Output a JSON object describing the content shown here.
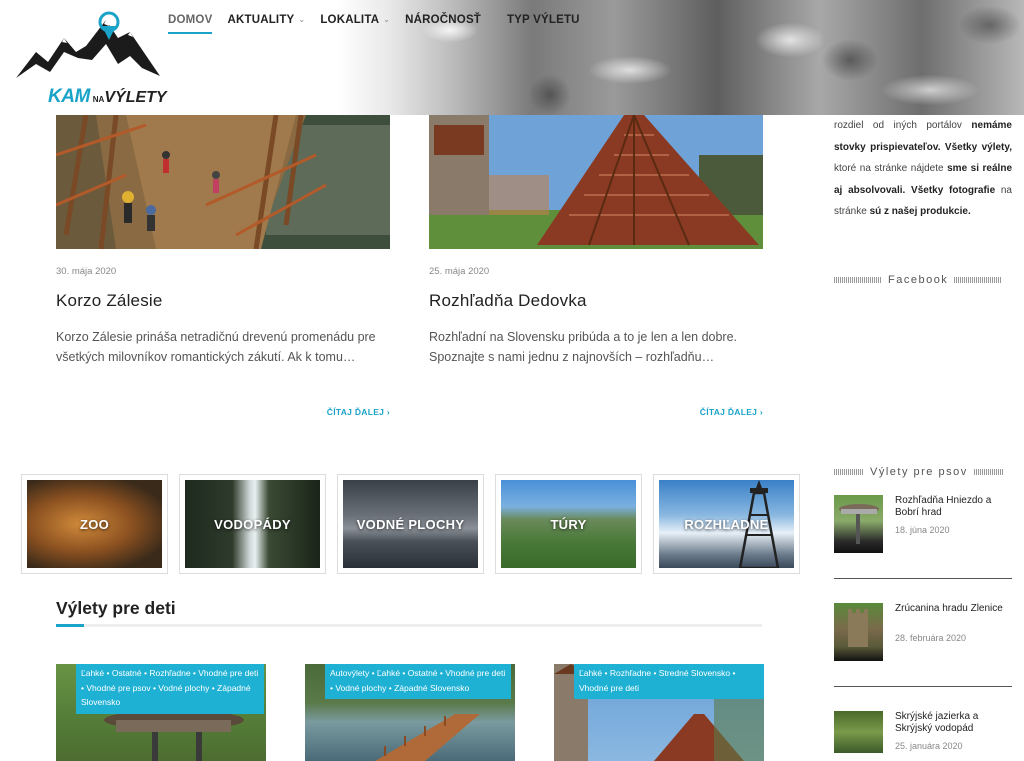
{
  "site": {
    "logo_kam": "KAM",
    "logo_na": "NA",
    "logo_vylety": "VÝLETY"
  },
  "nav": {
    "items": [
      {
        "label": "DOMOV",
        "active": true,
        "has_dropdown": false
      },
      {
        "label": "AKTUALITY",
        "active": false,
        "has_dropdown": true
      },
      {
        "label": "LOKALITA",
        "active": false,
        "has_dropdown": true
      },
      {
        "label": "NÁROČNOSŤ",
        "active": false,
        "has_dropdown": true
      },
      {
        "label": "TYP VÝLETU",
        "active": false,
        "has_dropdown": false
      }
    ]
  },
  "posts": [
    {
      "date": "30. mája 2020",
      "title": "Korzo Zálesie",
      "excerpt": "Korzo Zálesie prináša netradičnú drevenú promenádu pre všetkých milovníkov romantických zákutí. Ak k tomu…",
      "read_more": "ČÍTAJ ĎALEJ ›"
    },
    {
      "date": "25. mája 2020",
      "title": "Rozhľadňa Dedovka",
      "excerpt": "Rozhľadní na Slovensku pribúda a to je len a len dobre. Spoznajte s nami jednu z najnovších – rozhľadňu…",
      "read_more": "ČÍTAJ ĎALEJ ›"
    }
  ],
  "categories": [
    {
      "label": "ZOO"
    },
    {
      "label": "VODOPÁDY"
    },
    {
      "label": "VODNÉ PLOCHY"
    },
    {
      "label": "TÚRY"
    },
    {
      "label": "ROZHĽADNE"
    }
  ],
  "kids_section": {
    "title": "Výlety pre deti",
    "items": [
      {
        "tags": "Ľahké • Ostatné • Rozhľadne • Vhodné pre deti • Vhodné pre psov • Vodné plochy • Západné Slovensko"
      },
      {
        "tags": "Autovýlety • Ľahké • Ostatné • Vhodné pre deti • Vodné plochy • Západné Slovensko"
      },
      {
        "tags": "Ľahké • Rozhľadne • Stredné Slovensko • Vhodné pre deti"
      }
    ]
  },
  "sidebar": {
    "about": {
      "p1": "rozdiel od iných portálov ",
      "b1": "nemáme stovky prispievateľov. Všetky výlety,",
      "p2": " ktoré na stránke nájdete ",
      "b2": "sme si reálne aj absolvovali. Všetky fotografie",
      "p3": " na stránke ",
      "b3": "sú z našej produkcie."
    },
    "facebook_title": "Facebook",
    "dogs_title": "Výlety pre psov",
    "dog_items": [
      {
        "title": "Rozhľadňa Hniezdo a Bobrí hrad",
        "date": "18. júna 2020"
      },
      {
        "title": "Zrúcanina hradu Zlenice",
        "date": "28. februára 2020"
      },
      {
        "title": "Skrýjské jazierka a Skrýjský vodopád",
        "date": "25. januára 2020"
      }
    ]
  },
  "colors": {
    "accent": "#1aa3c8",
    "tag_bg": "#1eb1d4"
  }
}
